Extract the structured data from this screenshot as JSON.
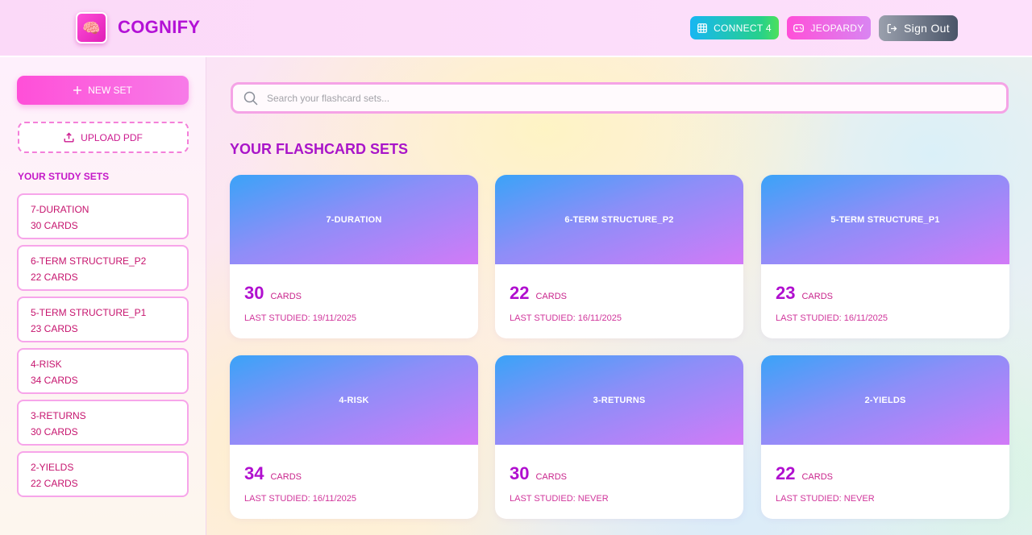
{
  "header": {
    "logo_emoji": "🧠",
    "app_name": "COGNIFY",
    "connect4_label": "CONNECT 4",
    "jeopardy_label": "JEOPARDY",
    "signout_label": "Sign Out"
  },
  "sidebar": {
    "new_set_label": "NEW SET",
    "upload_label": "UPLOAD PDF",
    "heading": "YOUR STUDY SETS",
    "items": [
      {
        "name": "7-DURATION",
        "count": "30 CARDS"
      },
      {
        "name": "6-TERM STRUCTURE_P2",
        "count": "22 CARDS"
      },
      {
        "name": "5-TERM STRUCTURE_P1",
        "count": "23 CARDS"
      },
      {
        "name": "4-RISK",
        "count": "34 CARDS"
      },
      {
        "name": "3-RETURNS",
        "count": "30 CARDS"
      },
      {
        "name": "2-YIELDS",
        "count": "22 CARDS"
      }
    ]
  },
  "main": {
    "search_placeholder": "Search your flashcard sets...",
    "title": "YOUR FLASHCARD SETS",
    "cards": [
      {
        "name": "7-DURATION",
        "count": "30",
        "unit": "CARDS",
        "last": "LAST STUDIED: 19/11/2025"
      },
      {
        "name": "6-TERM STRUCTURE_P2",
        "count": "22",
        "unit": "CARDS",
        "last": "LAST STUDIED: 16/11/2025"
      },
      {
        "name": "5-TERM STRUCTURE_P1",
        "count": "23",
        "unit": "CARDS",
        "last": "LAST STUDIED: 16/11/2025"
      },
      {
        "name": "4-RISK",
        "count": "34",
        "unit": "CARDS",
        "last": "LAST STUDIED: 16/11/2025"
      },
      {
        "name": "3-RETURNS",
        "count": "30",
        "unit": "CARDS",
        "last": "LAST STUDIED: NEVER"
      },
      {
        "name": "2-YIELDS",
        "count": "22",
        "unit": "CARDS",
        "last": "LAST STUDIED: NEVER"
      }
    ]
  },
  "colors": {
    "brand": "#b311d6",
    "accent_pink": "#ff4fd8",
    "card_gradient_start": "#3aa3f8",
    "card_gradient_end": "#d27af7"
  },
  "icons": {
    "logo": "brain-icon",
    "connect4": "grid-icon",
    "jeopardy": "gamepad-icon",
    "signout": "logout-icon",
    "new_set": "plus-icon",
    "upload": "upload-icon",
    "search": "search-icon"
  }
}
